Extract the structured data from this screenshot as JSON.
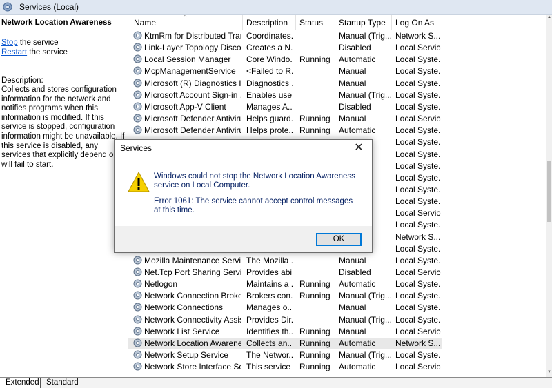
{
  "window": {
    "title": "Services (Local)"
  },
  "left_pane": {
    "service_title": "Network Location Awareness",
    "stop_link": "Stop",
    "stop_suffix": " the service",
    "restart_link": "Restart",
    "restart_suffix": " the service",
    "description_label": "Description:",
    "description": "Collects and stores configuration information for the network and notifies programs when this information is modified. If this service is stopped, configuration information might be unavailable. If this service is disabled, any services that explicitly depend on it will fail to start."
  },
  "columns": {
    "name": "Name",
    "description": "Description",
    "status": "Status",
    "startup_type": "Startup Type",
    "log_on_as": "Log On As"
  },
  "rows": [
    {
      "name": "KtmRm for Distributed Tran...",
      "desc": "Coordinates...",
      "status": "",
      "startup": "Manual (Trig...",
      "logon": "Network S..."
    },
    {
      "name": "Link-Layer Topology Discov...",
      "desc": "Creates a N...",
      "status": "",
      "startup": "Disabled",
      "logon": "Local Service"
    },
    {
      "name": "Local Session Manager",
      "desc": "Core Windo...",
      "status": "Running",
      "startup": "Automatic",
      "logon": "Local Syste..."
    },
    {
      "name": "McpManagementService",
      "desc": "<Failed to R...",
      "status": "",
      "startup": "Manual",
      "logon": "Local Syste..."
    },
    {
      "name": "Microsoft (R) Diagnostics H...",
      "desc": "Diagnostics ...",
      "status": "",
      "startup": "Manual",
      "logon": "Local Syste..."
    },
    {
      "name": "Microsoft Account Sign-in ...",
      "desc": "Enables use...",
      "status": "",
      "startup": "Manual (Trig...",
      "logon": "Local Syste..."
    },
    {
      "name": "Microsoft App-V Client",
      "desc": "Manages A...",
      "status": "",
      "startup": "Disabled",
      "logon": "Local Syste..."
    },
    {
      "name": "Microsoft Defender Antiviru...",
      "desc": "Helps guard...",
      "status": "Running",
      "startup": "Manual",
      "logon": "Local Service"
    },
    {
      "name": "Microsoft Defender Antiviru...",
      "desc": "Helps prote...",
      "status": "Running",
      "startup": "Automatic",
      "logon": "Local Syste..."
    },
    {
      "name": "",
      "desc": "",
      "status": "",
      "startup": "",
      "logon": "Local Syste..."
    },
    {
      "name": "",
      "desc": "",
      "status": "",
      "startup": "c (Tr...",
      "logon": "Local Syste..."
    },
    {
      "name": "",
      "desc": "",
      "status": "",
      "startup": "rig...",
      "logon": "Local Syste..."
    },
    {
      "name": "",
      "desc": "",
      "status": "",
      "startup": "",
      "logon": "Local Syste..."
    },
    {
      "name": "",
      "desc": "",
      "status": "",
      "startup": "rig...",
      "logon": "Local Syste..."
    },
    {
      "name": "",
      "desc": "",
      "status": "",
      "startup": "rig...",
      "logon": "Local Syste..."
    },
    {
      "name": "",
      "desc": "",
      "status": "",
      "startup": "rig...",
      "logon": "Local Service"
    },
    {
      "name": "",
      "desc": "",
      "status": "",
      "startup": "",
      "logon": "Local Syste..."
    },
    {
      "name": "",
      "desc": "",
      "status": "",
      "startup": "",
      "logon": "Network S..."
    },
    {
      "name": "",
      "desc": "",
      "status": "",
      "startup": "",
      "logon": "Local Syste..."
    },
    {
      "name": "Mozilla Maintenance Service",
      "desc": "The Mozilla ...",
      "status": "",
      "startup": "Manual",
      "logon": "Local Syste..."
    },
    {
      "name": "Net.Tcp Port Sharing Service",
      "desc": "Provides abi...",
      "status": "",
      "startup": "Disabled",
      "logon": "Local Service"
    },
    {
      "name": "Netlogon",
      "desc": "Maintains a ...",
      "status": "Running",
      "startup": "Automatic",
      "logon": "Local Syste..."
    },
    {
      "name": "Network Connection Broker",
      "desc": "Brokers con...",
      "status": "Running",
      "startup": "Manual (Trig...",
      "logon": "Local Syste..."
    },
    {
      "name": "Network Connections",
      "desc": "Manages o...",
      "status": "",
      "startup": "Manual",
      "logon": "Local Syste..."
    },
    {
      "name": "Network Connectivity Assis...",
      "desc": "Provides Dir...",
      "status": "",
      "startup": "Manual (Trig...",
      "logon": "Local Syste..."
    },
    {
      "name": "Network List Service",
      "desc": "Identifies th...",
      "status": "Running",
      "startup": "Manual",
      "logon": "Local Service"
    },
    {
      "name": "Network Location Awareness",
      "desc": "Collects an...",
      "status": "Running",
      "startup": "Automatic",
      "logon": "Network S...",
      "selected": true
    },
    {
      "name": "Network Setup Service",
      "desc": "The Networ...",
      "status": "Running",
      "startup": "Manual (Trig...",
      "logon": "Local Syste..."
    },
    {
      "name": "Network Store Interface Ser...",
      "desc": "This service ...",
      "status": "Running",
      "startup": "Automatic",
      "logon": "Local Service"
    }
  ],
  "tabs": {
    "extended": "Extended",
    "standard": "Standard"
  },
  "dialog": {
    "title": "Services",
    "message": "Windows could not stop the Network Location Awareness service on Local Computer.",
    "error": "Error 1061: The service cannot accept control messages at this time.",
    "ok_label": "OK"
  },
  "colors": {
    "title_bar": "#dfe7f2",
    "link": "#0b57d0",
    "selected_row": "#e8e8e8",
    "dialog_text": "#001c60",
    "ok_border": "#0078d7"
  },
  "icons": {
    "window": "gear-icon",
    "row": "service-gear-icon",
    "dialog": "warning-icon",
    "close": "close-icon"
  }
}
